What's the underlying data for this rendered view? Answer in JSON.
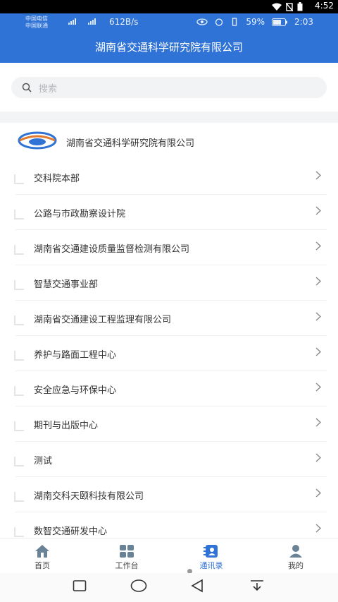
{
  "system_bar": {
    "time": "4:52"
  },
  "app_status": {
    "carrier_1": "中国电信",
    "carrier_2": "中国联通",
    "speed": "612B/s",
    "battery": "59%",
    "clock": "2:03"
  },
  "header": {
    "title": "湖南省交通科学研究院有限公司"
  },
  "search": {
    "placeholder": "搜索"
  },
  "org": {
    "name": "湖南省交通科学研究院有限公司"
  },
  "departments": [
    {
      "label": "交科院本部"
    },
    {
      "label": "公路与市政勘察设计院"
    },
    {
      "label": "湖南省交通建设质量监督检测有限公司"
    },
    {
      "label": "智慧交通事业部"
    },
    {
      "label": "湖南省交通建设工程监理有限公司"
    },
    {
      "label": "养护与路面工程中心"
    },
    {
      "label": "安全应急与环保中心"
    },
    {
      "label": "期刊与出版中心"
    },
    {
      "label": "测试"
    },
    {
      "label": "湖南交科天颐科技有限公司"
    },
    {
      "label": "数智交通研发中心"
    }
  ],
  "tabs": [
    {
      "label": "首页",
      "icon": "home-icon"
    },
    {
      "label": "工作台",
      "icon": "grid-icon"
    },
    {
      "label": "通讯录",
      "icon": "contacts-icon",
      "active": true
    },
    {
      "label": "我的",
      "icon": "profile-icon"
    }
  ],
  "colors": {
    "primary": "#2f73d6",
    "band": "#f3f4f6"
  }
}
